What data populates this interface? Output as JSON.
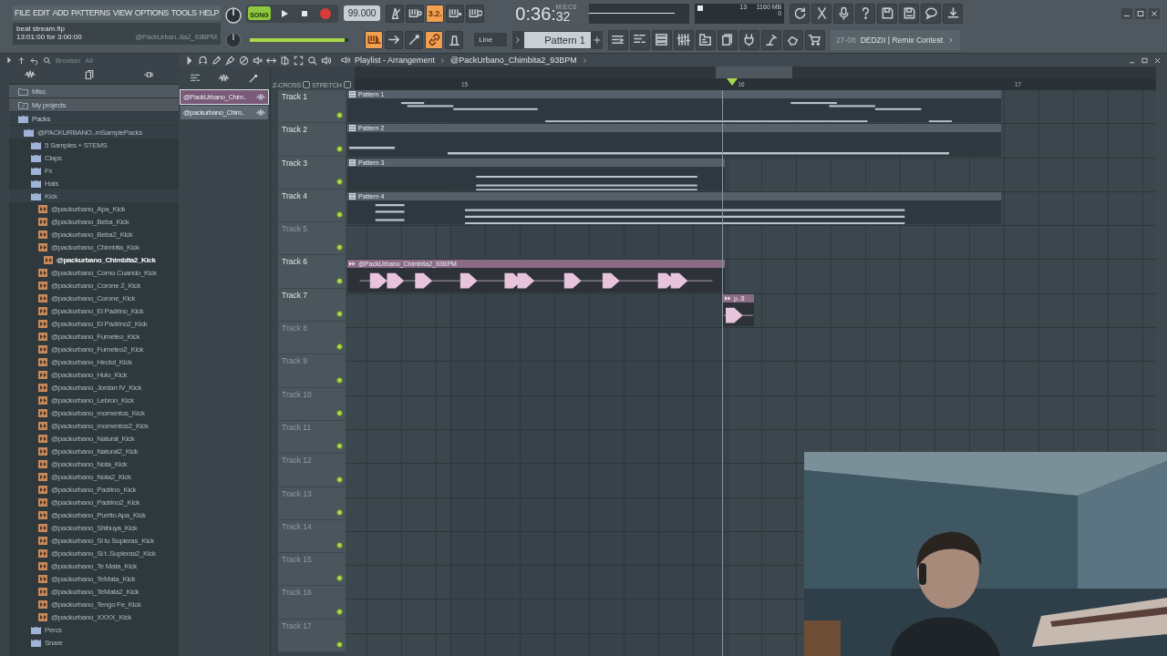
{
  "menu": [
    "FILE",
    "EDIT",
    "ADD",
    "PATTERNS",
    "VIEW",
    "OPTIONS",
    "TOOLS",
    "HELP"
  ],
  "hint": {
    "file": "beat stream.flp",
    "time": "13:01:00 for 3:00:00",
    "pattern": "@PackUrban..ita2_93BPM"
  },
  "transport": {
    "mode": "SONG",
    "song_on": true,
    "tempo": "99.000",
    "time_main": "0:36:",
    "time_fraction": "32",
    "time_label": "M:S:CS",
    "master_volume": {
      "level": 0.96
    }
  },
  "toggles_top": [
    {
      "kind": "metronome",
      "on": false
    },
    {
      "kind": "wait",
      "on": false
    },
    {
      "kind": "countdown",
      "label": "3.2.",
      "on": true
    },
    {
      "kind": "blend",
      "on": false
    },
    {
      "kind": "loop",
      "on": false
    }
  ],
  "toggles_bottom": [
    {
      "kind": "typing-keyboard",
      "on": true
    },
    {
      "kind": "step-edit",
      "on": false
    },
    {
      "kind": "slide",
      "on": false
    },
    {
      "kind": "link",
      "on": true
    },
    {
      "kind": "hat",
      "on": false
    }
  ],
  "snap": "Line",
  "pattern": "Pattern 1",
  "monitor": {
    "voices": "13",
    "memory": "1160 MB",
    "cpu": "0"
  },
  "news": {
    "date": "27-08",
    "text": "DEDZII | Remix Contest"
  },
  "browser": {
    "title": "Browser",
    "filter": "All",
    "tree": [
      {
        "label": "Misc",
        "kind": "folder",
        "expanded": false
      },
      {
        "label": "My projects",
        "kind": "link",
        "expanded": false
      },
      {
        "label": "Packs",
        "kind": "pack",
        "expanded": true,
        "children": [
          {
            "label": "@PACKURBANO..mSamplePacks",
            "kind": "pack",
            "expanded": true,
            "children": [
              {
                "label": "5 Samples + STEMS",
                "kind": "pack",
                "expanded": false
              },
              {
                "label": "Claps",
                "kind": "pack",
                "expanded": false
              },
              {
                "label": "Fx",
                "kind": "pack",
                "expanded": false
              },
              {
                "label": "Hats",
                "kind": "pack",
                "expanded": false
              },
              {
                "label": "Kick",
                "kind": "pack",
                "expanded": true,
                "children": [
                  {
                    "label": "@packurbano_Apa_Kick",
                    "kind": "sample",
                    "selected": false
                  },
                  {
                    "label": "@packurbano_Beba_Kick",
                    "kind": "sample",
                    "selected": false
                  },
                  {
                    "label": "@packurbano_Beba2_Kick",
                    "kind": "sample",
                    "selected": false
                  },
                  {
                    "label": "@packurbano_Chimbita_Kick",
                    "kind": "sample",
                    "selected": false
                  },
                  {
                    "label": "@packurbano_Chimbita2_Kick",
                    "kind": "sample",
                    "selected": true
                  },
                  {
                    "label": "@packurbano_Como Cuando_Kick",
                    "kind": "sample",
                    "selected": false
                  },
                  {
                    "label": "@packurbano_Corone 2_Kick",
                    "kind": "sample",
                    "selected": false
                  },
                  {
                    "label": "@packurbano_Corone_Kick",
                    "kind": "sample",
                    "selected": false
                  },
                  {
                    "label": "@packurbano_El Padrino_Kick",
                    "kind": "sample",
                    "selected": false
                  },
                  {
                    "label": "@packurbano_El Padrino2_Kick",
                    "kind": "sample",
                    "selected": false
                  },
                  {
                    "label": "@packurbano_Fumeteo_Kick",
                    "kind": "sample",
                    "selected": false
                  },
                  {
                    "label": "@packurbano_Fumeteo2_Kick",
                    "kind": "sample",
                    "selected": false
                  },
                  {
                    "label": "@packurbano_Hectol_Kick",
                    "kind": "sample",
                    "selected": false
                  },
                  {
                    "label": "@packurbano_Hulu_Kick",
                    "kind": "sample",
                    "selected": false
                  },
                  {
                    "label": "@packurbano_Jordan IV_Kick",
                    "kind": "sample",
                    "selected": false
                  },
                  {
                    "label": "@packurbano_Lebron_Kick",
                    "kind": "sample",
                    "selected": false
                  },
                  {
                    "label": "@packurbano_momentos_Kick",
                    "kind": "sample",
                    "selected": false
                  },
                  {
                    "label": "@packurbano_momentos2_Kick",
                    "kind": "sample",
                    "selected": false
                  },
                  {
                    "label": "@packurbano_Natural_Kick",
                    "kind": "sample",
                    "selected": false
                  },
                  {
                    "label": "@packurbano_Natural2_Kick",
                    "kind": "sample",
                    "selected": false
                  },
                  {
                    "label": "@packurbano_Nota_Kick",
                    "kind": "sample",
                    "selected": false
                  },
                  {
                    "label": "@packurbano_Nota2_Kick",
                    "kind": "sample",
                    "selected": false
                  },
                  {
                    "label": "@packurbano_Padrino_Kick",
                    "kind": "sample",
                    "selected": false
                  },
                  {
                    "label": "@packurbano_Padrino2_Kick",
                    "kind": "sample",
                    "selected": false
                  },
                  {
                    "label": "@packurbano_Purrito Apa_Kick",
                    "kind": "sample",
                    "selected": false
                  },
                  {
                    "label": "@packurbano_Shibuya_Kick",
                    "kind": "sample",
                    "selected": false
                  },
                  {
                    "label": "@packurbano_Si tu Supieras_Kick",
                    "kind": "sample",
                    "selected": false
                  },
                  {
                    "label": "@packurbano_Si t..Supieras2_Kick",
                    "kind": "sample",
                    "selected": false
                  },
                  {
                    "label": "@packurbano_Te Mata_Kick",
                    "kind": "sample",
                    "selected": false
                  },
                  {
                    "label": "@packurbano_TeMata_Kick",
                    "kind": "sample",
                    "selected": false
                  },
                  {
                    "label": "@packurbano_TeMata2_Kick",
                    "kind": "sample",
                    "selected": false
                  },
                  {
                    "label": "@packurbano_Tengo Fe_Kick",
                    "kind": "sample",
                    "selected": false
                  },
                  {
                    "label": "@packurbano_XXXX_Kick",
                    "kind": "sample",
                    "selected": false
                  }
                ]
              },
              {
                "label": "Percs",
                "kind": "pack",
                "expanded": false
              },
              {
                "label": "Snare",
                "kind": "pack",
                "expanded": false
              }
            ]
          }
        ]
      }
    ]
  },
  "picker": [
    {
      "label": "@PackUrbano_Chim..",
      "selected": true
    },
    {
      "label": "@packurbano_Chim..",
      "selected": false
    }
  ],
  "playlist": {
    "title": "Playlist - Arrangement",
    "pattern": "@PackUrbano_Chimbita2_93BPM",
    "zcross": "Z-CROSS",
    "zcross_checked": false,
    "stretch": "STRETCH",
    "stretch_checked": false,
    "ruler": [
      "15",
      "16",
      "17"
    ],
    "tracks": [
      {
        "name": "Track 1",
        "empty": false,
        "clip": {
          "kind": "pattern",
          "label": "Pattern 1"
        }
      },
      {
        "name": "Track 2",
        "empty": false,
        "clip": {
          "kind": "pattern",
          "label": "Pattern 2"
        }
      },
      {
        "name": "Track 3",
        "empty": false,
        "clip": {
          "kind": "pattern",
          "label": "Pattern 3"
        }
      },
      {
        "name": "Track 4",
        "empty": false,
        "clip": {
          "kind": "pattern",
          "label": "Pattern 4"
        }
      },
      {
        "name": "Track 5",
        "empty": true
      },
      {
        "name": "Track 6",
        "empty": false,
        "clip": {
          "kind": "audio",
          "label": "@PackUrbano_Chimbita2_93BPM"
        }
      },
      {
        "name": "Track 7",
        "empty": false,
        "clip": {
          "kind": "audio",
          "label": "p..8"
        }
      },
      {
        "name": "Track 8",
        "empty": true
      },
      {
        "name": "Track 9",
        "empty": true
      },
      {
        "name": "Track 10",
        "empty": true
      },
      {
        "name": "Track 11",
        "empty": true
      },
      {
        "name": "Track 12",
        "empty": true
      },
      {
        "name": "Track 13",
        "empty": true
      },
      {
        "name": "Track 14",
        "empty": true
      },
      {
        "name": "Track 15",
        "empty": true
      },
      {
        "name": "Track 16",
        "empty": true
      },
      {
        "name": "Track 17",
        "empty": true
      }
    ]
  }
}
